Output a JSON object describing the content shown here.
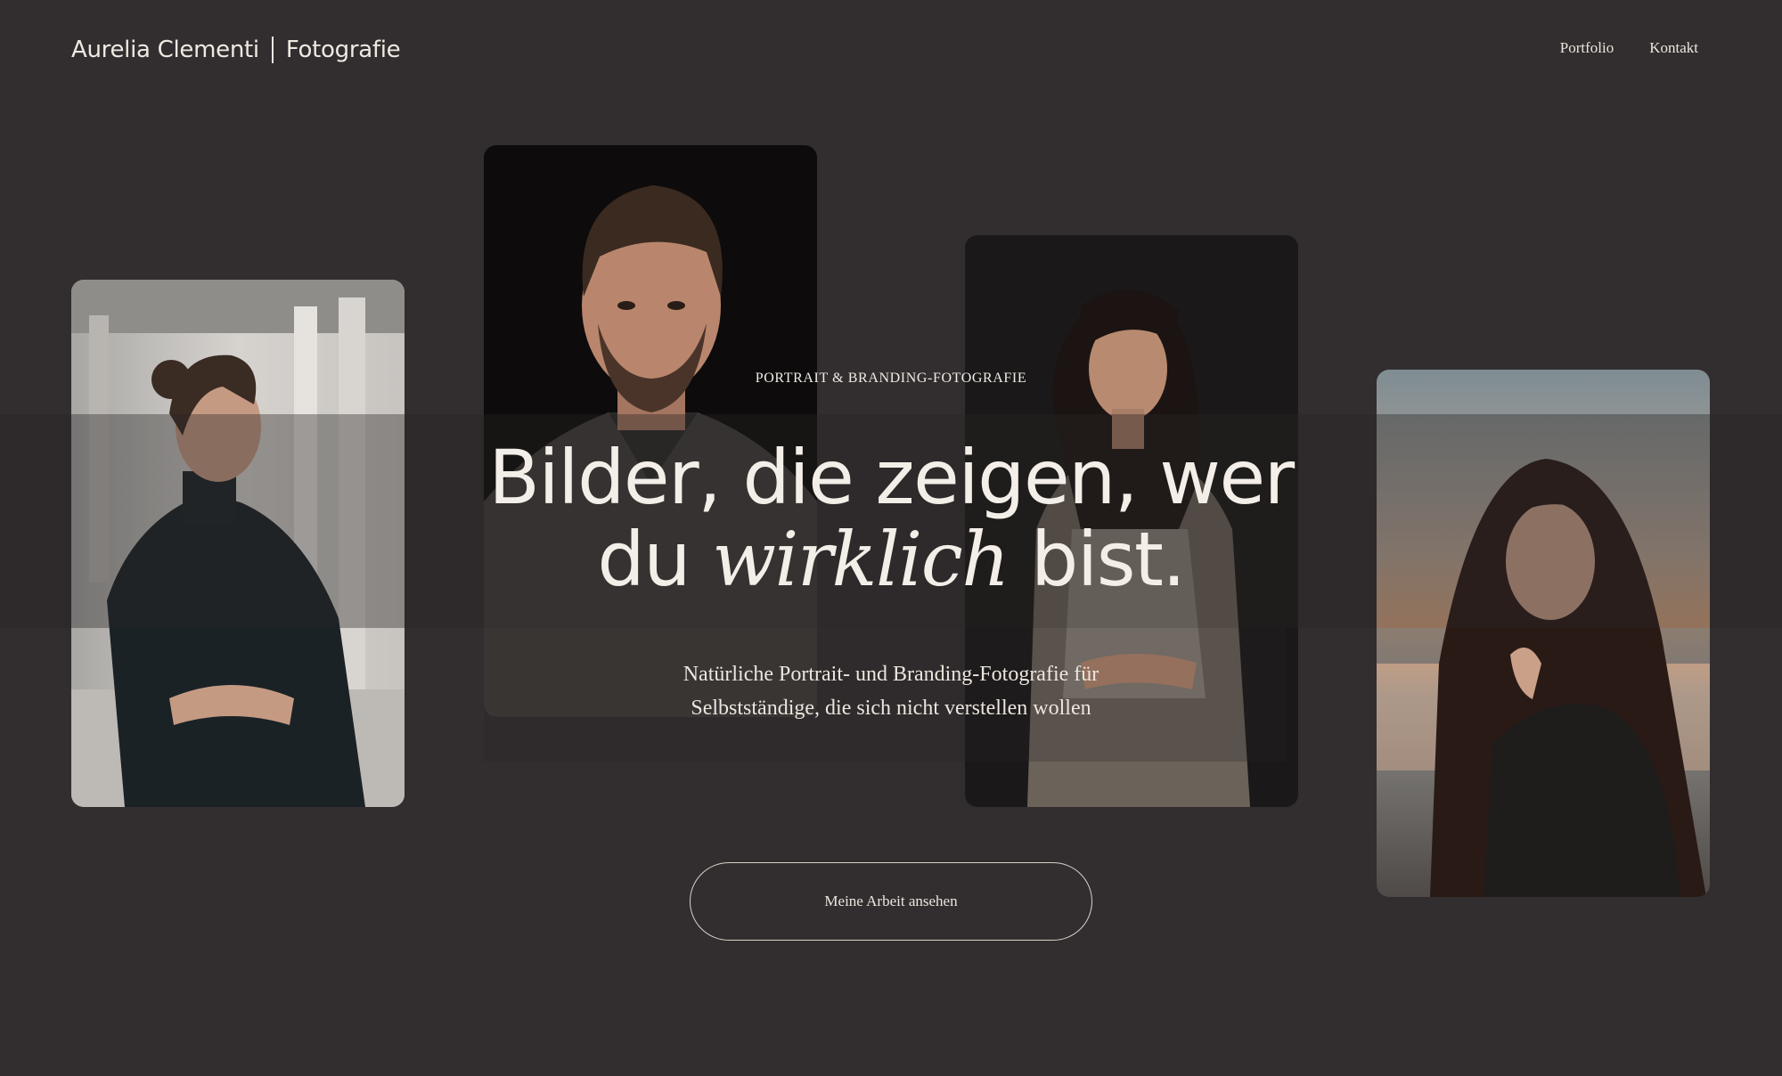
{
  "header": {
    "brand_name": "Aurelia Clementi",
    "brand_suffix": "Fotografie",
    "nav": [
      {
        "label": "Portfolio"
      },
      {
        "label": "Kontakt"
      }
    ]
  },
  "hero": {
    "eyebrow": "PORTRAIT & BRANDING-FOTOGRAFIE",
    "headline_line1": "Bilder, die zeigen, wer",
    "headline_line2_start": "du",
    "headline_line2_em": "wirklich",
    "headline_line2_end": "bist.",
    "subtitle_line1": "Natürliche Portrait- und Branding-Fotografie für",
    "subtitle_line2": "Selbstständige, die sich nicht verstellen wollen",
    "cta_label": "Meine Arbeit ansehen"
  },
  "colors": {
    "background": "#322e2f",
    "text": "#ece6df"
  }
}
